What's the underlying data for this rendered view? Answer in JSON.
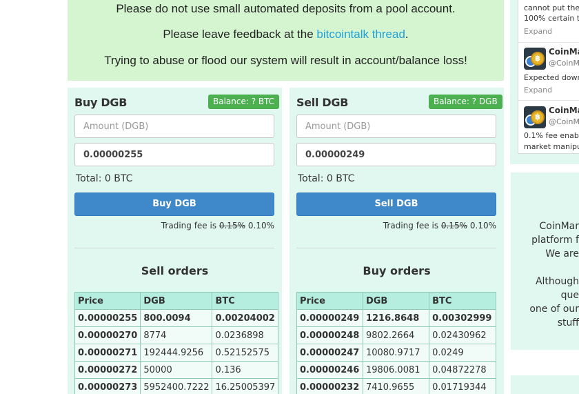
{
  "notice": {
    "line1": "Please do not use small automated deposits from a pool account.",
    "line2_prefix": "Please leave feedback at the",
    "line2_link": "bitcointalk thread",
    "line2_suffix": ".",
    "line3": "Trying to abuse or flood our system will result in account/balance loss!"
  },
  "buy_panel": {
    "title": "Buy DGB",
    "balance": "Balance: ? BTC",
    "amount_placeholder": "Amount (DGB)",
    "price_value": "0.00000255",
    "total_label": "Total:",
    "total_value": "0 BTC",
    "button": "Buy DGB",
    "fee_prefix": "Trading fee is",
    "fee_old": "0.15%",
    "fee_new": "0.10%",
    "orders_title": "Sell orders",
    "columns": [
      "Price",
      "DGB",
      "BTC"
    ],
    "rows": [
      [
        "0.00000255",
        "800.0094",
        "0.00204002"
      ],
      [
        "0.00000270",
        "8774",
        "0.0236898"
      ],
      [
        "0.00000271",
        "192444.9256",
        "0.52152575"
      ],
      [
        "0.00000272",
        "50000",
        "0.136"
      ],
      [
        "0.00000273",
        "5952400.7222",
        "16.25005397"
      ]
    ]
  },
  "sell_panel": {
    "title": "Sell DGB",
    "balance": "Balance: ? DGB",
    "amount_placeholder": "Amount (DGB)",
    "price_value": "0.00000249",
    "total_label": "Total:",
    "total_value": "0 BTC",
    "button": "Sell DGB",
    "fee_prefix": "Trading fee is",
    "fee_old": "0.15%",
    "fee_new": "0.10%",
    "orders_title": "Buy orders",
    "columns": [
      "Price",
      "DGB",
      "BTC"
    ],
    "rows": [
      [
        "0.00000249",
        "1216.8648",
        "0.00302999"
      ],
      [
        "0.00000248",
        "9802.2664",
        "0.02430962"
      ],
      [
        "0.00000247",
        "10080.9717",
        "0.0249"
      ],
      [
        "0.00000246",
        "19806.0081",
        "0.04872278"
      ],
      [
        "0.00000232",
        "7410.9655",
        "0.01719344"
      ]
    ]
  },
  "twitter": {
    "tweet0_line1": "cannot put the",
    "tweet0_line2": "100% certain t",
    "expand": "Expand",
    "tweet1_name": "CoinMar",
    "tweet1_handle": "@CoinM",
    "tweet1_text": "Expected dowr",
    "tweet2_name": "CoinMar",
    "tweet2_handle": "@CoinM",
    "tweet2_text1": "0.1% fee enab",
    "tweet2_text2": "market manipu"
  },
  "sidebar_text": {
    "lines": [
      "CoinMar",
      "platform f",
      "We are",
      "",
      "Although",
      "que",
      "one of our",
      "stuff"
    ]
  },
  "colors": {
    "notice_bg": "#d4f5cf",
    "panel_bg": "#e0f8ef",
    "badge": "#4caf50",
    "button": "#3f88c9",
    "table_header": "#b5eedf",
    "link": "#1fa0d8"
  }
}
